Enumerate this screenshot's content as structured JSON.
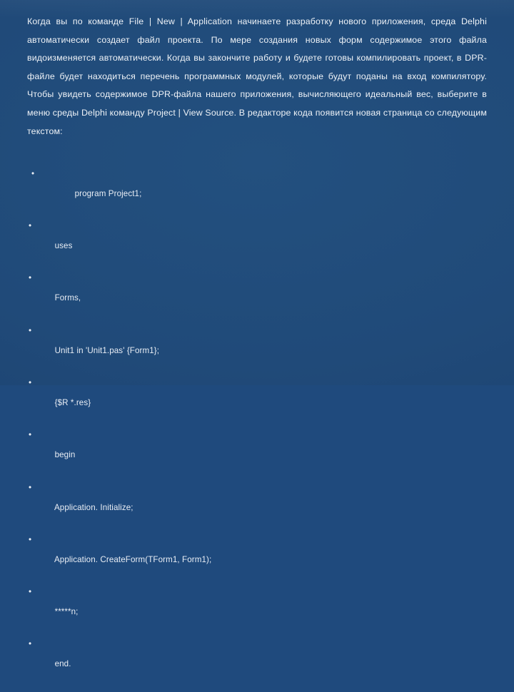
{
  "slide": {
    "background_color": "#1f4a7d",
    "text_color": "#eef2f7",
    "paragraph": "Когда вы по команде File | New | Application начинаете разработку нового приложения, среда Delphi автоматически создает файл проекта. По мере создания новых форм содержимое этого файла видоизменяется автоматически. Когда вы закончите работу и будете готовы компилировать проект, в DPR-файле будет находиться перечень программных модулей, которые будут поданы на вход компилятору. Чтобы увидеть содержимое DPR-файла нашего приложения, вычисляющего идеальный вес, выберите в меню среды Delphi команду Project | View Source. В редакторе кода появится новая страница со следующим текстом:",
    "bullet_glyph": "•",
    "code_lines": [
      "program Project1;",
      "uses",
      "Forms,",
      "Unit1 in 'Unit1.pas' {Form1};",
      "{$R *.res}",
      "begin",
      "Application. Initialize;",
      "Application. CreateForm(TForm1, Form1);",
      "*****n;",
      "end."
    ]
  }
}
